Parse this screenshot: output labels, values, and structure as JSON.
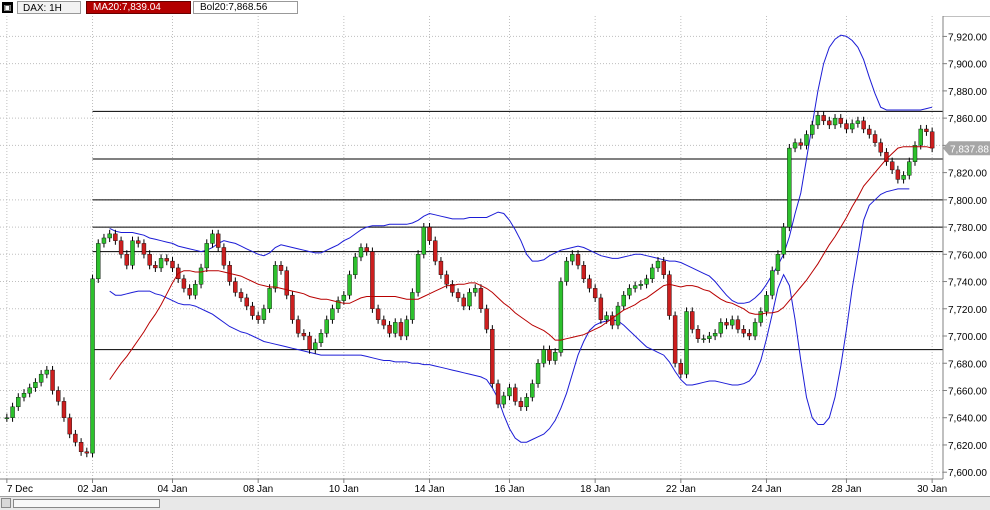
{
  "header": {
    "symbol_label": "DAX: 1H",
    "ma_label": "MA20:7,839.04",
    "bol_label": "Bol20:7,868.56"
  },
  "colors": {
    "up": "#2dc12d",
    "down": "#cc1f1f",
    "ma": "#b80000",
    "bands": "#1c1cd6",
    "grid": "#bfbfbf",
    "price_tag_bg": "#a6a6a6"
  },
  "chart_data": {
    "type": "candlestick",
    "ylim": [
      7595,
      7935
    ],
    "y_ticks": [
      7600,
      7620,
      7640,
      7660,
      7680,
      7700,
      7720,
      7740,
      7760,
      7780,
      7800,
      7820,
      7840,
      7860,
      7880,
      7900,
      7920
    ],
    "y_tick_labels": [
      "7,600.00",
      "7,620.00",
      "7,640.00",
      "7,660.00",
      "7,680.00",
      "7,700.00",
      "7,720.00",
      "7,740.00",
      "7,760.00",
      "7,780.00",
      "7,800.00",
      "7,820.00",
      "7,840.00",
      "7,860.00",
      "7,880.00",
      "7,900.00",
      "7,920.00"
    ],
    "x_labels": [
      "7 Dec",
      "02 Jan",
      "04 Jan",
      "08 Jan",
      "10 Jan",
      "14 Jan",
      "16 Jan",
      "18 Jan",
      "22 Jan",
      "24 Jan",
      "28 Jan",
      "30 Jan"
    ],
    "last_price_label": "7,837.88",
    "last_price": 7837.88,
    "closes": [
      7640,
      7648,
      7655,
      7658,
      7662,
      7666,
      7672,
      7675,
      7660,
      7652,
      7640,
      7628,
      7622,
      7615,
      7614,
      7742,
      7768,
      7772,
      7775,
      7770,
      7760,
      7752,
      7770,
      7768,
      7760,
      7752,
      7750,
      7757,
      7755,
      7750,
      7742,
      7735,
      7730,
      7738,
      7750,
      7768,
      7775,
      7765,
      7752,
      7740,
      7732,
      7728,
      7722,
      7715,
      7712,
      7720,
      7735,
      7752,
      7748,
      7730,
      7712,
      7702,
      7700,
      7690,
      7695,
      7702,
      7712,
      7720,
      7726,
      7730,
      7745,
      7758,
      7765,
      7762,
      7720,
      7712,
      7708,
      7702,
      7710,
      7700,
      7712,
      7732,
      7760,
      7780,
      7770,
      7755,
      7745,
      7738,
      7732,
      7728,
      7722,
      7732,
      7735,
      7720,
      7705,
      7665,
      7650,
      7656,
      7662,
      7652,
      7648,
      7655,
      7665,
      7680,
      7690,
      7682,
      7688,
      7740,
      7755,
      7760,
      7752,
      7742,
      7735,
      7728,
      7712,
      7715,
      7708,
      7722,
      7730,
      7735,
      7737,
      7738,
      7742,
      7750,
      7755,
      7745,
      7715,
      7680,
      7672,
      7718,
      7705,
      7698,
      7698,
      7700,
      7702,
      7710,
      7708,
      7712,
      7705,
      7702,
      7700,
      7710,
      7718,
      7730,
      7748,
      7760,
      7780,
      7838,
      7842,
      7840,
      7848,
      7855,
      7862,
      7858,
      7855,
      7860,
      7856,
      7852,
      7856,
      7858,
      7852,
      7848,
      7842,
      7835,
      7828,
      7822,
      7815,
      7818,
      7828,
      7840,
      7852,
      7850,
      7838
    ],
    "ma20": [
      null,
      null,
      null,
      null,
      null,
      null,
      null,
      null,
      null,
      null,
      null,
      null,
      null,
      null,
      null,
      null,
      null,
      null,
      7668,
      7674,
      7680,
      7685,
      7691,
      7697,
      7703,
      7710,
      7716,
      7723,
      7731,
      7739,
      7746,
      7748,
      7748,
      7747,
      7747,
      7748,
      7748,
      7748,
      7747,
      7746,
      7745,
      7744,
      7742,
      7740,
      7738,
      7737,
      7736,
      7736,
      7735,
      7734,
      7733,
      7732,
      7731,
      7729,
      7728,
      7727,
      7727,
      7726,
      7725,
      7724,
      7724,
      7726,
      7728,
      7729,
      7729,
      7729,
      7729,
      7729,
      7729,
      7728,
      7727,
      7727,
      7727,
      7729,
      7731,
      7733,
      7735,
      7737,
      7737,
      7738,
      7738,
      7739,
      7739,
      7737,
      7735,
      7732,
      7728,
      7724,
      7721,
      7717,
      7714,
      7711,
      7708,
      7706,
      7704,
      7701,
      7697,
      7697,
      7698,
      7699,
      7700,
      7701,
      7703,
      7705,
      7707,
      7710,
      7713,
      7716,
      7719,
      7721,
      7723,
      7726,
      7728,
      7731,
      7734,
      7737,
      7738,
      7737,
      7736,
      7737,
      7737,
      7736,
      7734,
      7733,
      7730,
      7727,
      7725,
      7724,
      7722,
      7720,
      7717,
      7716,
      7716,
      7717,
      7717,
      7718,
      7721,
      7726,
      7731,
      7736,
      7741,
      7747,
      7753,
      7760,
      7767,
      7773,
      7780,
      7787,
      7795,
      7802,
      7810,
      7815,
      7820,
      7825,
      7830,
      7834,
      7838,
      7839,
      7839,
      7839,
      7839,
      7839,
      7838
    ],
    "bol_upper": [
      null,
      null,
      null,
      null,
      null,
      null,
      null,
      null,
      null,
      null,
      null,
      null,
      null,
      null,
      null,
      null,
      null,
      null,
      7779,
      7777,
      7776,
      7776,
      7776,
      7775,
      7774,
      7772,
      7771,
      7770,
      7769,
      7768,
      7766,
      7765,
      7764,
      7763,
      7762,
      7763,
      7765,
      7768,
      7770,
      7769,
      7768,
      7766,
      7764,
      7762,
      7760,
      7759,
      7761,
      7765,
      7767,
      7766,
      7765,
      7764,
      7763,
      7762,
      7761,
      7761,
      7763,
      7765,
      7767,
      7770,
      7772,
      7775,
      7778,
      7780,
      7781,
      7781,
      7781,
      7782,
      7782,
      7782,
      7782,
      7783,
      7785,
      7788,
      7790,
      7789,
      7788,
      7787,
      7786,
      7786,
      7786,
      7787,
      7787,
      7787,
      7787,
      7789,
      7791,
      7790,
      7785,
      7778,
      7770,
      7760,
      7755,
      7755,
      7756,
      7759,
      7761,
      7763,
      7764,
      7765,
      7766,
      7765,
      7763,
      7761,
      7759,
      7758,
      7757,
      7757,
      7758,
      7759,
      7760,
      7760,
      7759,
      7758,
      7757,
      7756,
      7755,
      7755,
      7754,
      7752,
      7750,
      7748,
      7746,
      7744,
      7740,
      7735,
      7730,
      7726,
      7724,
      7724,
      7725,
      7728,
      7732,
      7738,
      7745,
      7752,
      7760,
      7773,
      7790,
      7805,
      7830,
      7855,
      7880,
      7900,
      7912,
      7918,
      7921,
      7920,
      7917,
      7912,
      7903,
      7890,
      7878,
      7868,
      7866,
      7866,
      7866,
      7866,
      7866,
      7866,
      7866,
      7867,
      7868
    ],
    "bol_lower": [
      null,
      null,
      null,
      null,
      null,
      null,
      null,
      null,
      null,
      null,
      null,
      null,
      null,
      null,
      null,
      null,
      null,
      null,
      7733,
      7730,
      7730,
      7731,
      7732,
      7733,
      7733,
      7733,
      7731,
      7730,
      7728,
      7726,
      7724,
      7723,
      7723,
      7722,
      7720,
      7718,
      7716,
      7713,
      7710,
      7707,
      7705,
      7703,
      7702,
      7700,
      7698,
      7696,
      7695,
      7694,
      7693,
      7692,
      7691,
      7690,
      7689,
      7688,
      7687,
      7686,
      7686,
      7686,
      7686,
      7686,
      7686,
      7686,
      7686,
      7685,
      7684,
      7683,
      7682,
      7682,
      7681,
      7681,
      7681,
      7680,
      7680,
      7679,
      7679,
      7678,
      7677,
      7676,
      7675,
      7674,
      7673,
      7672,
      7671,
      7670,
      7668,
      7662,
      7654,
      7642,
      7632,
      7625,
      7622,
      7622,
      7624,
      7626,
      7628,
      7632,
      7638,
      7647,
      7658,
      7672,
      7686,
      7696,
      7704,
      7708,
      7710,
      7711,
      7712,
      7711,
      7708,
      7704,
      7700,
      7696,
      7692,
      7690,
      7688,
      7686,
      7681,
      7674,
      7668,
      7664,
      7664,
      7665,
      7666,
      7667,
      7667,
      7666,
      7665,
      7664,
      7664,
      7665,
      7667,
      7672,
      7682,
      7698,
      7716,
      7735,
      7745,
      7737,
      7712,
      7682,
      7655,
      7640,
      7635,
      7635,
      7640,
      7655,
      7678,
      7705,
      7735,
      7760,
      7785,
      7796,
      7800,
      7804,
      7806,
      7807,
      7808,
      7808,
      7808
    ],
    "horizontal_lines": [
      7690,
      7780,
      7762,
      7865,
      7830,
      7800
    ]
  }
}
